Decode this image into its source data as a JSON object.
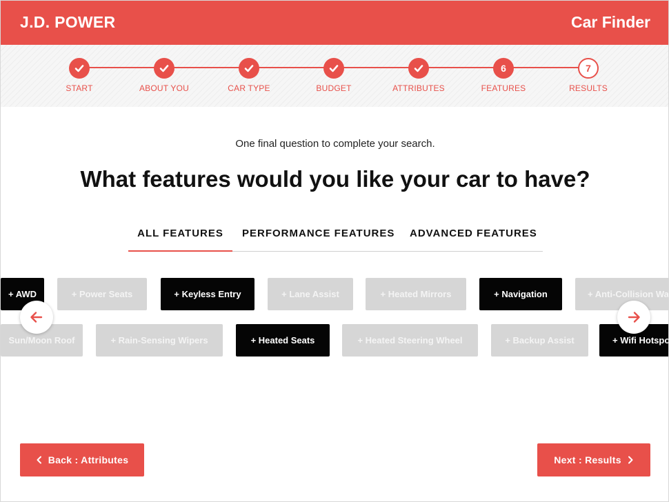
{
  "header": {
    "brand": "J.D. POWER",
    "app_title": "Car Finder"
  },
  "progress": {
    "steps": [
      {
        "label": "START",
        "state": "done",
        "marker": "check-icon"
      },
      {
        "label": "ABOUT YOU",
        "state": "done",
        "marker": "check-icon"
      },
      {
        "label": "CAR TYPE",
        "state": "done",
        "marker": "check-icon"
      },
      {
        "label": "BUDGET",
        "state": "done",
        "marker": "check-icon"
      },
      {
        "label": "ATTRIBUTES",
        "state": "done",
        "marker": "check-icon"
      },
      {
        "label": "FEATURES",
        "state": "current",
        "number": "6"
      },
      {
        "label": "RESULTS",
        "state": "upcoming",
        "number": "7"
      }
    ]
  },
  "subtitle": "One final question to complete your search.",
  "question": "What features would you like your car to have?",
  "tabs": [
    {
      "label": "ALL FEATURES",
      "active": true
    },
    {
      "label": "PERFORMANCE FEATURES",
      "active": false
    },
    {
      "label": "ADVANCED FEATURES",
      "active": false
    }
  ],
  "features": {
    "row1": [
      {
        "label": "+ AWD",
        "selected": true
      },
      {
        "label": "+ Power Seats",
        "selected": false
      },
      {
        "label": "+ Keyless Entry",
        "selected": true
      },
      {
        "label": "+ Lane Assist",
        "selected": false
      },
      {
        "label": "+ Heated Mirrors",
        "selected": false
      },
      {
        "label": "+ Navigation",
        "selected": true
      },
      {
        "label": "+ Anti-Collision Wa",
        "selected": false
      }
    ],
    "row2": [
      {
        "label": "Sun/Moon Roof",
        "selected": false
      },
      {
        "label": "+ Rain-Sensing Wipers",
        "selected": false
      },
      {
        "label": "+ Heated Seats",
        "selected": true
      },
      {
        "label": "+ Heated Steering Wheel",
        "selected": false
      },
      {
        "label": "+ Backup Assist",
        "selected": false
      },
      {
        "label": "+ Wifi Hotspo",
        "selected": true
      }
    ]
  },
  "carousel": {
    "prev_icon": "arrow-left-icon",
    "next_icon": "arrow-right-icon"
  },
  "nav": {
    "back_label": "Back : Attributes",
    "next_label": "Next : Results"
  },
  "colors": {
    "accent": "#e8504a",
    "chip_selected": "#050505",
    "chip_unselected": "#d6d6d6"
  }
}
